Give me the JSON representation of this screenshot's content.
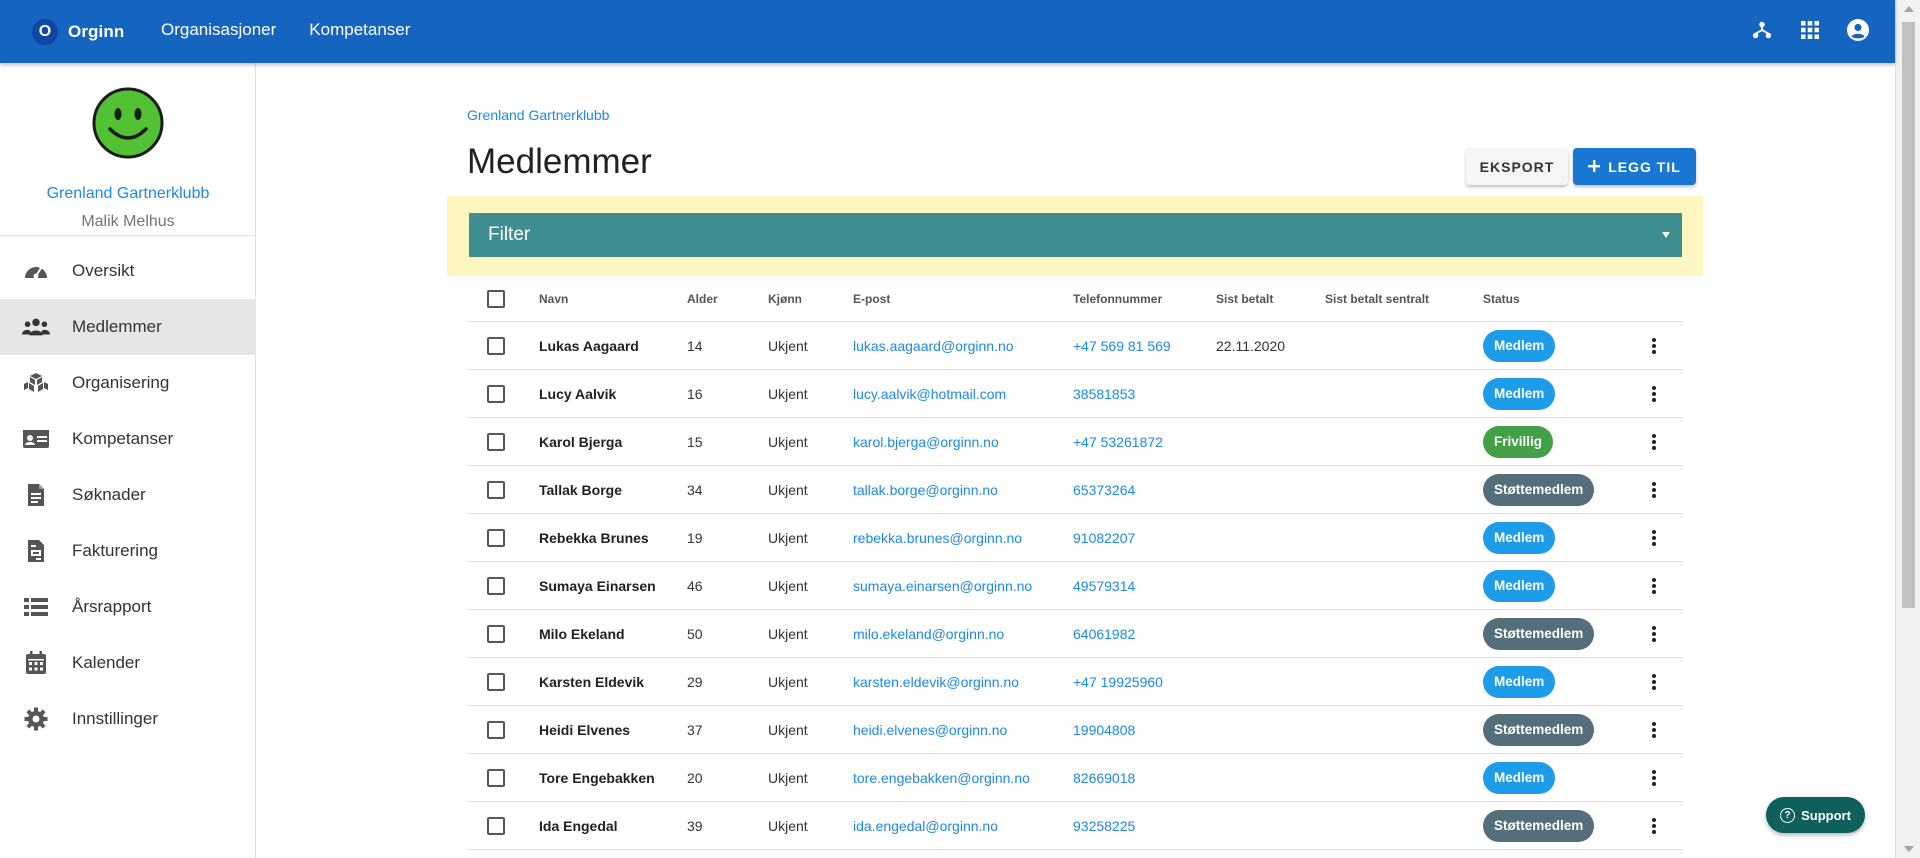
{
  "topbar": {
    "brand_letter": "O",
    "brand_name": "Orginn",
    "nav": [
      "Organisasjoner",
      "Kompetanser"
    ],
    "icons": [
      "hierarchy-icon",
      "apps-grid-icon",
      "account-circle-icon"
    ]
  },
  "sidebar": {
    "org_name": "Grenland Gartnerklubb",
    "user_name": "Malik Melhus",
    "items": [
      {
        "label": "Oversikt",
        "icon": "dashboard-icon"
      },
      {
        "label": "Medlemmer",
        "icon": "people-icon",
        "active": true
      },
      {
        "label": "Organisering",
        "icon": "organization-icon"
      },
      {
        "label": "Kompetanser",
        "icon": "id-card-icon"
      },
      {
        "label": "Søknader",
        "icon": "document-icon"
      },
      {
        "label": "Fakturering",
        "icon": "invoice-icon"
      },
      {
        "label": "Årsrapport",
        "icon": "list-icon"
      },
      {
        "label": "Kalender",
        "icon": "calendar-icon"
      },
      {
        "label": "Innstillinger",
        "icon": "gear-icon"
      }
    ]
  },
  "main": {
    "breadcrumb": "Grenland Gartnerklubb",
    "title": "Medlemmer",
    "export_label": "EKSPORT",
    "add_label": "LEGG TIL",
    "filter_label": "Filter"
  },
  "table": {
    "headers": {
      "name": "Navn",
      "age": "Alder",
      "gender": "Kjønn",
      "email": "E-post",
      "phone": "Telefonnummer",
      "last_paid": "Sist betalt",
      "last_paid_central": "Sist betalt sentralt",
      "status": "Status"
    },
    "rows": [
      {
        "name": "Lukas Aagaard",
        "age": "14",
        "gender": "Ukjent",
        "email": "lukas.aagaard@orginn.no",
        "phone": "+47 569 81 569",
        "last_paid": "22.11.2020",
        "last_paid_central": "",
        "status": "Medlem"
      },
      {
        "name": "Lucy Aalvik",
        "age": "16",
        "gender": "Ukjent",
        "email": "lucy.aalvik@hotmail.com",
        "phone": "38581853",
        "last_paid": "",
        "last_paid_central": "",
        "status": "Medlem"
      },
      {
        "name": "Karol Bjerga",
        "age": "15",
        "gender": "Ukjent",
        "email": "karol.bjerga@orginn.no",
        "phone": "+47 53261872",
        "last_paid": "",
        "last_paid_central": "",
        "status": "Frivillig"
      },
      {
        "name": "Tallak Borge",
        "age": "34",
        "gender": "Ukjent",
        "email": "tallak.borge@orginn.no",
        "phone": "65373264",
        "last_paid": "",
        "last_paid_central": "",
        "status": "Støttemedlem"
      },
      {
        "name": "Rebekka Brunes",
        "age": "19",
        "gender": "Ukjent",
        "email": "rebekka.brunes@orginn.no",
        "phone": "91082207",
        "last_paid": "",
        "last_paid_central": "",
        "status": "Medlem"
      },
      {
        "name": "Sumaya Einarsen",
        "age": "46",
        "gender": "Ukjent",
        "email": "sumaya.einarsen@orginn.no",
        "phone": "49579314",
        "last_paid": "",
        "last_paid_central": "",
        "status": "Medlem"
      },
      {
        "name": "Milo Ekeland",
        "age": "50",
        "gender": "Ukjent",
        "email": "milo.ekeland@orginn.no",
        "phone": "64061982",
        "last_paid": "",
        "last_paid_central": "",
        "status": "Støttemedlem"
      },
      {
        "name": "Karsten Eldevik",
        "age": "29",
        "gender": "Ukjent",
        "email": "karsten.eldevik@orginn.no",
        "phone": "+47 19925960",
        "last_paid": "",
        "last_paid_central": "",
        "status": "Medlem"
      },
      {
        "name": "Heidi Elvenes",
        "age": "37",
        "gender": "Ukjent",
        "email": "heidi.elvenes@orginn.no",
        "phone": "19904808",
        "last_paid": "",
        "last_paid_central": "",
        "status": "Støttemedlem"
      },
      {
        "name": "Tore Engebakken",
        "age": "20",
        "gender": "Ukjent",
        "email": "tore.engebakken@orginn.no",
        "phone": "82669018",
        "last_paid": "",
        "last_paid_central": "",
        "status": "Medlem"
      },
      {
        "name": "Ida Engedal",
        "age": "39",
        "gender": "Ukjent",
        "email": "ida.engedal@orginn.no",
        "phone": "93258225",
        "last_paid": "",
        "last_paid_central": "",
        "status": "Støttemedlem"
      }
    ]
  },
  "status_colors": {
    "Medlem": "#1e9be9",
    "Frivillig": "#43a047",
    "Støttemedlem": "#546e7a"
  },
  "support_label": "Support",
  "colors": {
    "topbar": "#1565c0",
    "filter_bar": "#3e8e90",
    "filter_bg": "#fdf6c1",
    "link": "#1e88e5",
    "primary_button": "#1976d2",
    "support": "#0f5f5c"
  }
}
